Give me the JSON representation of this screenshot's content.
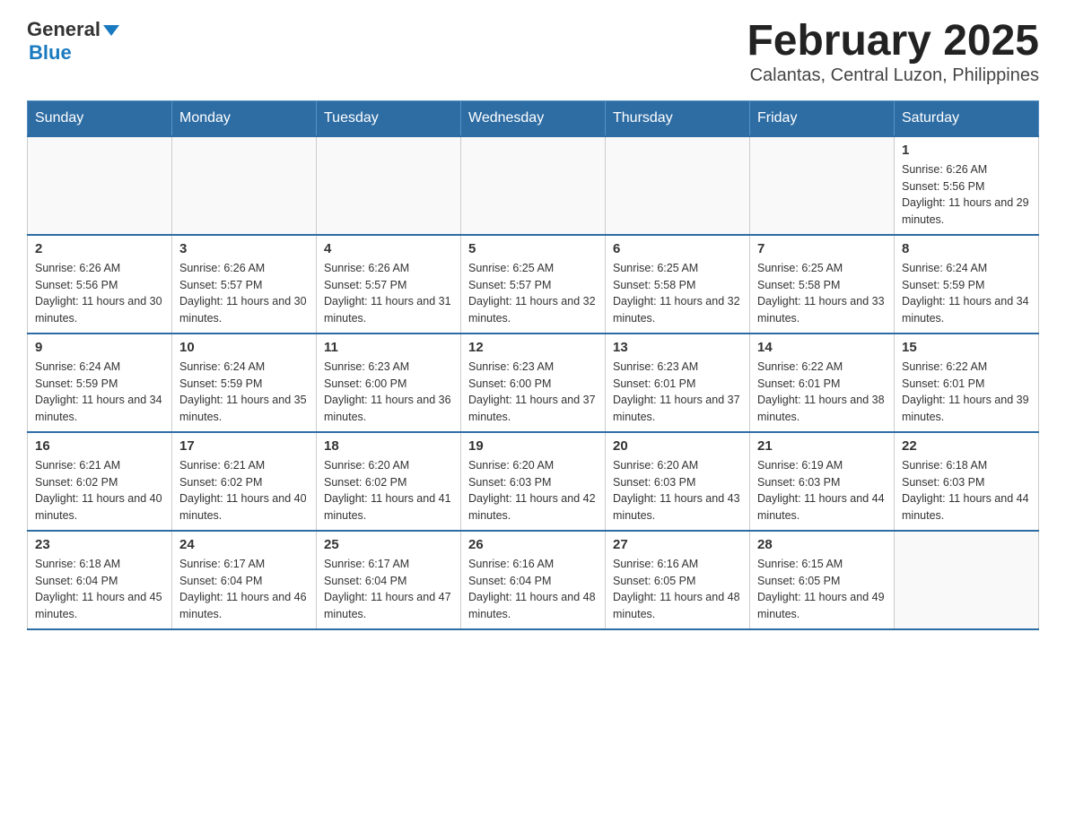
{
  "header": {
    "logo_general": "General",
    "logo_blue": "Blue",
    "title": "February 2025",
    "subtitle": "Calantas, Central Luzon, Philippines"
  },
  "days_of_week": [
    "Sunday",
    "Monday",
    "Tuesday",
    "Wednesday",
    "Thursday",
    "Friday",
    "Saturday"
  ],
  "weeks": [
    {
      "days": [
        {
          "number": "",
          "info": ""
        },
        {
          "number": "",
          "info": ""
        },
        {
          "number": "",
          "info": ""
        },
        {
          "number": "",
          "info": ""
        },
        {
          "number": "",
          "info": ""
        },
        {
          "number": "",
          "info": ""
        },
        {
          "number": "1",
          "info": "Sunrise: 6:26 AM\nSunset: 5:56 PM\nDaylight: 11 hours and 29 minutes."
        }
      ]
    },
    {
      "days": [
        {
          "number": "2",
          "info": "Sunrise: 6:26 AM\nSunset: 5:56 PM\nDaylight: 11 hours and 30 minutes."
        },
        {
          "number": "3",
          "info": "Sunrise: 6:26 AM\nSunset: 5:57 PM\nDaylight: 11 hours and 30 minutes."
        },
        {
          "number": "4",
          "info": "Sunrise: 6:26 AM\nSunset: 5:57 PM\nDaylight: 11 hours and 31 minutes."
        },
        {
          "number": "5",
          "info": "Sunrise: 6:25 AM\nSunset: 5:57 PM\nDaylight: 11 hours and 32 minutes."
        },
        {
          "number": "6",
          "info": "Sunrise: 6:25 AM\nSunset: 5:58 PM\nDaylight: 11 hours and 32 minutes."
        },
        {
          "number": "7",
          "info": "Sunrise: 6:25 AM\nSunset: 5:58 PM\nDaylight: 11 hours and 33 minutes."
        },
        {
          "number": "8",
          "info": "Sunrise: 6:24 AM\nSunset: 5:59 PM\nDaylight: 11 hours and 34 minutes."
        }
      ]
    },
    {
      "days": [
        {
          "number": "9",
          "info": "Sunrise: 6:24 AM\nSunset: 5:59 PM\nDaylight: 11 hours and 34 minutes."
        },
        {
          "number": "10",
          "info": "Sunrise: 6:24 AM\nSunset: 5:59 PM\nDaylight: 11 hours and 35 minutes."
        },
        {
          "number": "11",
          "info": "Sunrise: 6:23 AM\nSunset: 6:00 PM\nDaylight: 11 hours and 36 minutes."
        },
        {
          "number": "12",
          "info": "Sunrise: 6:23 AM\nSunset: 6:00 PM\nDaylight: 11 hours and 37 minutes."
        },
        {
          "number": "13",
          "info": "Sunrise: 6:23 AM\nSunset: 6:01 PM\nDaylight: 11 hours and 37 minutes."
        },
        {
          "number": "14",
          "info": "Sunrise: 6:22 AM\nSunset: 6:01 PM\nDaylight: 11 hours and 38 minutes."
        },
        {
          "number": "15",
          "info": "Sunrise: 6:22 AM\nSunset: 6:01 PM\nDaylight: 11 hours and 39 minutes."
        }
      ]
    },
    {
      "days": [
        {
          "number": "16",
          "info": "Sunrise: 6:21 AM\nSunset: 6:02 PM\nDaylight: 11 hours and 40 minutes."
        },
        {
          "number": "17",
          "info": "Sunrise: 6:21 AM\nSunset: 6:02 PM\nDaylight: 11 hours and 40 minutes."
        },
        {
          "number": "18",
          "info": "Sunrise: 6:20 AM\nSunset: 6:02 PM\nDaylight: 11 hours and 41 minutes."
        },
        {
          "number": "19",
          "info": "Sunrise: 6:20 AM\nSunset: 6:03 PM\nDaylight: 11 hours and 42 minutes."
        },
        {
          "number": "20",
          "info": "Sunrise: 6:20 AM\nSunset: 6:03 PM\nDaylight: 11 hours and 43 minutes."
        },
        {
          "number": "21",
          "info": "Sunrise: 6:19 AM\nSunset: 6:03 PM\nDaylight: 11 hours and 44 minutes."
        },
        {
          "number": "22",
          "info": "Sunrise: 6:18 AM\nSunset: 6:03 PM\nDaylight: 11 hours and 44 minutes."
        }
      ]
    },
    {
      "days": [
        {
          "number": "23",
          "info": "Sunrise: 6:18 AM\nSunset: 6:04 PM\nDaylight: 11 hours and 45 minutes."
        },
        {
          "number": "24",
          "info": "Sunrise: 6:17 AM\nSunset: 6:04 PM\nDaylight: 11 hours and 46 minutes."
        },
        {
          "number": "25",
          "info": "Sunrise: 6:17 AM\nSunset: 6:04 PM\nDaylight: 11 hours and 47 minutes."
        },
        {
          "number": "26",
          "info": "Sunrise: 6:16 AM\nSunset: 6:04 PM\nDaylight: 11 hours and 48 minutes."
        },
        {
          "number": "27",
          "info": "Sunrise: 6:16 AM\nSunset: 6:05 PM\nDaylight: 11 hours and 48 minutes."
        },
        {
          "number": "28",
          "info": "Sunrise: 6:15 AM\nSunset: 6:05 PM\nDaylight: 11 hours and 49 minutes."
        },
        {
          "number": "",
          "info": ""
        }
      ]
    }
  ]
}
